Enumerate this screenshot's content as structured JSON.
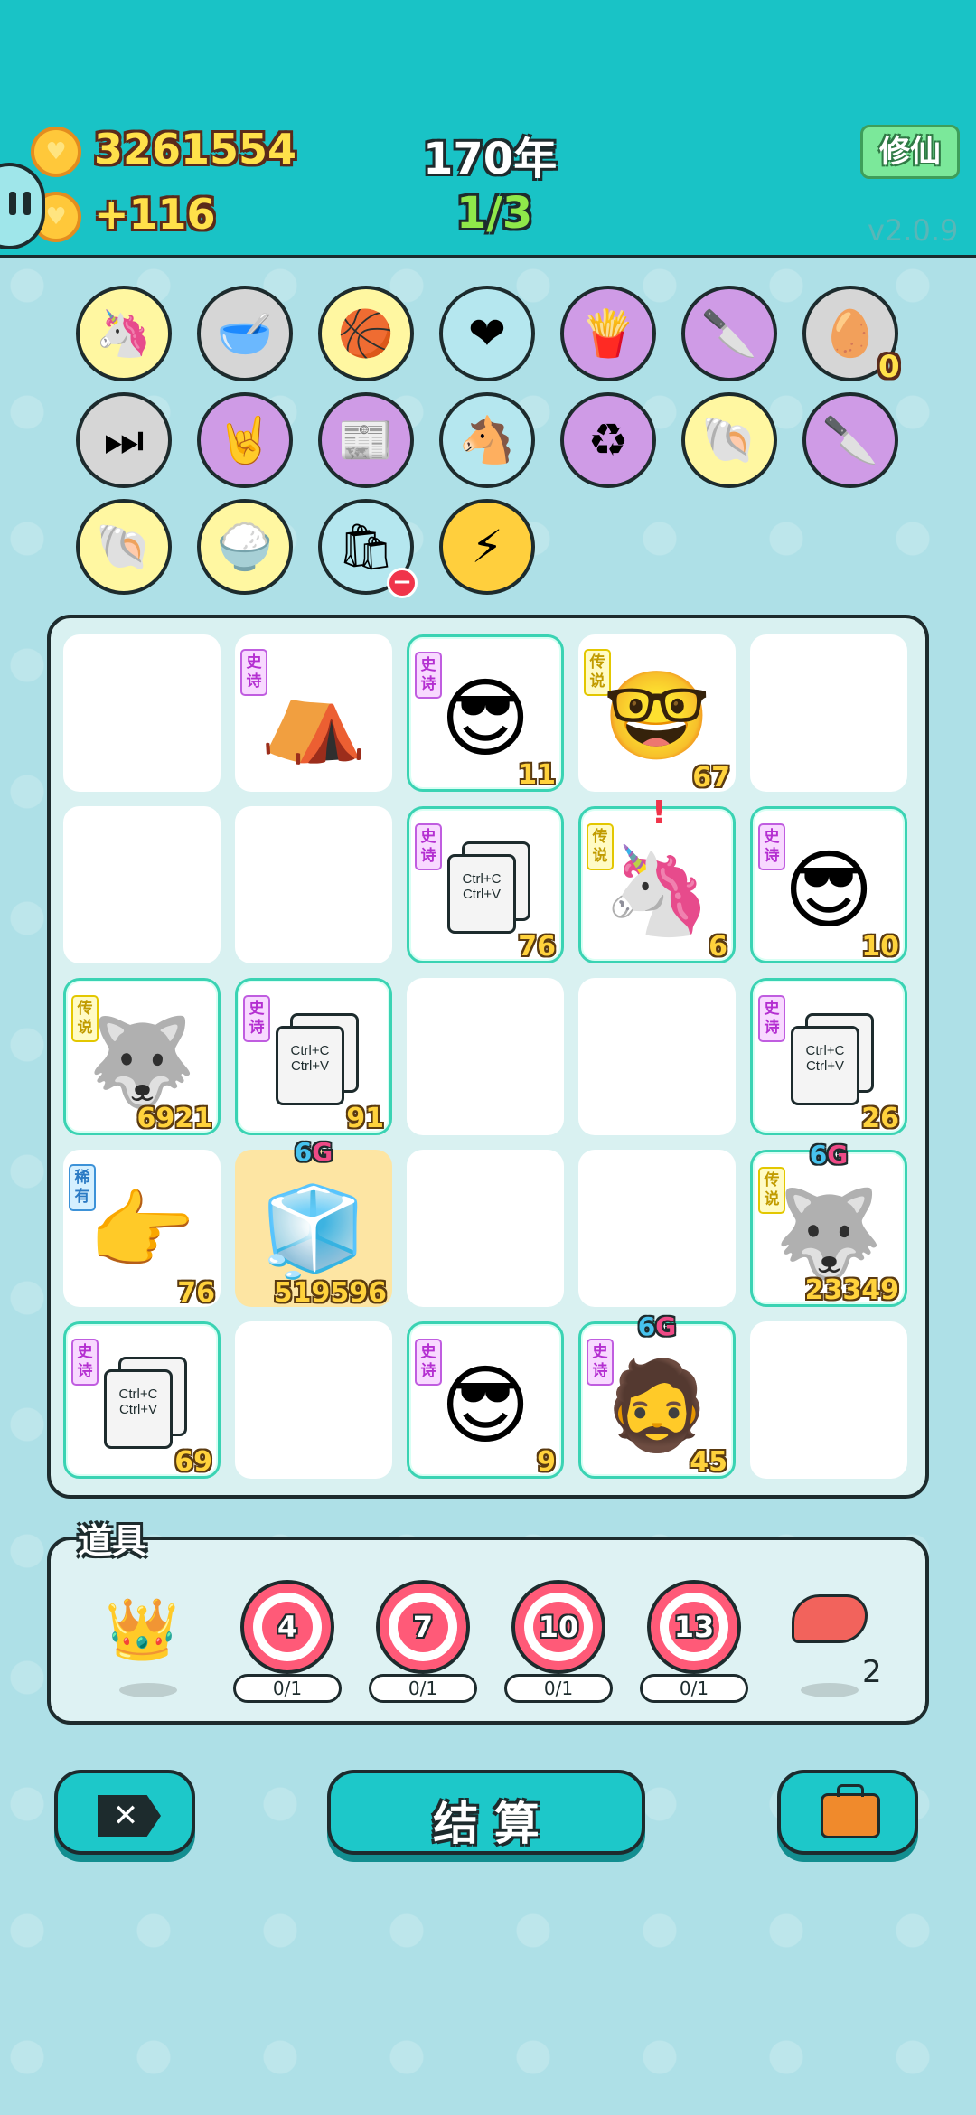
{
  "header": {
    "coins": "3261554",
    "income": "+116",
    "year": "170年",
    "progress": "1/3",
    "mode_button": "修仙",
    "version": "v2.0.9"
  },
  "inventory": {
    "row1": [
      {
        "icon": "unicorn-icon",
        "bg": "yellow"
      },
      {
        "icon": "dog-bowl-icon",
        "bg": "grey"
      },
      {
        "icon": "basketballs-icon",
        "bg": "yellow"
      },
      {
        "icon": "heart-fan-icon",
        "bg": "lightblue"
      },
      {
        "icon": "fries-icon",
        "bg": "purple"
      },
      {
        "icon": "cleaver-icon",
        "bg": "purple"
      },
      {
        "icon": "egg-tray-icon",
        "bg": "grey",
        "count": "0"
      }
    ],
    "row2": [
      {
        "icon": "skip-icon",
        "bg": "grey"
      },
      {
        "icon": "rock-hand-icon",
        "bg": "purple"
      },
      {
        "icon": "time-magazine-icon",
        "bg": "purple"
      },
      {
        "icon": "twin-horses-icon",
        "bg": "lightblue"
      },
      {
        "icon": "recycle-icon",
        "bg": "purple"
      },
      {
        "icon": "shell-icon",
        "bg": "yellow"
      },
      {
        "icon": "cleaver-icon",
        "bg": "purple"
      }
    ],
    "row3": [
      {
        "icon": "shell-icon",
        "bg": "yellow"
      },
      {
        "icon": "rice-bowl-icon",
        "bg": "yellow"
      },
      {
        "icon": "sack-icon",
        "bg": "lightblue"
      },
      {
        "icon": "lightning-icon",
        "bg": "yellow"
      }
    ]
  },
  "board": {
    "tags": {
      "epic": "史诗",
      "legend": "传说",
      "rare": "稀有"
    },
    "cells": {
      "r1c2": {
        "tag": "史诗"
      },
      "r1c3": {
        "tag": "史诗",
        "num": "11"
      },
      "r1c4": {
        "tag": "传说",
        "num": "67"
      },
      "r2c3": {
        "tag": "史诗",
        "num": "76",
        "l1": "Ctrl+C",
        "l2": "Ctrl+V"
      },
      "r2c4": {
        "tag": "传说",
        "num": "6"
      },
      "r2c5": {
        "tag": "史诗",
        "num": "10"
      },
      "r3c1": {
        "tag": "传说",
        "num": "6921"
      },
      "r3c2": {
        "tag": "史诗",
        "num": "91",
        "l1": "Ctrl+C",
        "l2": "Ctrl+V"
      },
      "r3c5": {
        "tag": "史诗",
        "num": "26",
        "l1": "Ctrl+C",
        "l2": "Ctrl+V"
      },
      "r4c1": {
        "tag": "稀有",
        "num": "76"
      },
      "r4c2": {
        "num": "519596",
        "six": "6",
        "g": "G"
      },
      "r4c5": {
        "tag": "传说",
        "num": "23349",
        "six": "6",
        "g": "G"
      },
      "r5c1": {
        "tag": "史诗",
        "num": "69",
        "l1": "Ctrl+C",
        "l2": "Ctrl+V"
      },
      "r5c3": {
        "tag": "史诗",
        "num": "9"
      },
      "r5c4": {
        "tag": "史诗",
        "num": "45",
        "six": "6",
        "g": "G"
      }
    }
  },
  "props": {
    "title": "道具",
    "targets": [
      {
        "value": "4",
        "count": "0/1"
      },
      {
        "value": "7",
        "count": "0/1"
      },
      {
        "value": "10",
        "count": "0/1"
      },
      {
        "value": "13",
        "count": "0/1"
      }
    ],
    "liver_count": "2"
  },
  "footer": {
    "settle_label": "结 算"
  },
  "colors": {
    "topbar": "#19c3c6",
    "accent": "#1dc8c9",
    "coin": "#ffc83a"
  }
}
